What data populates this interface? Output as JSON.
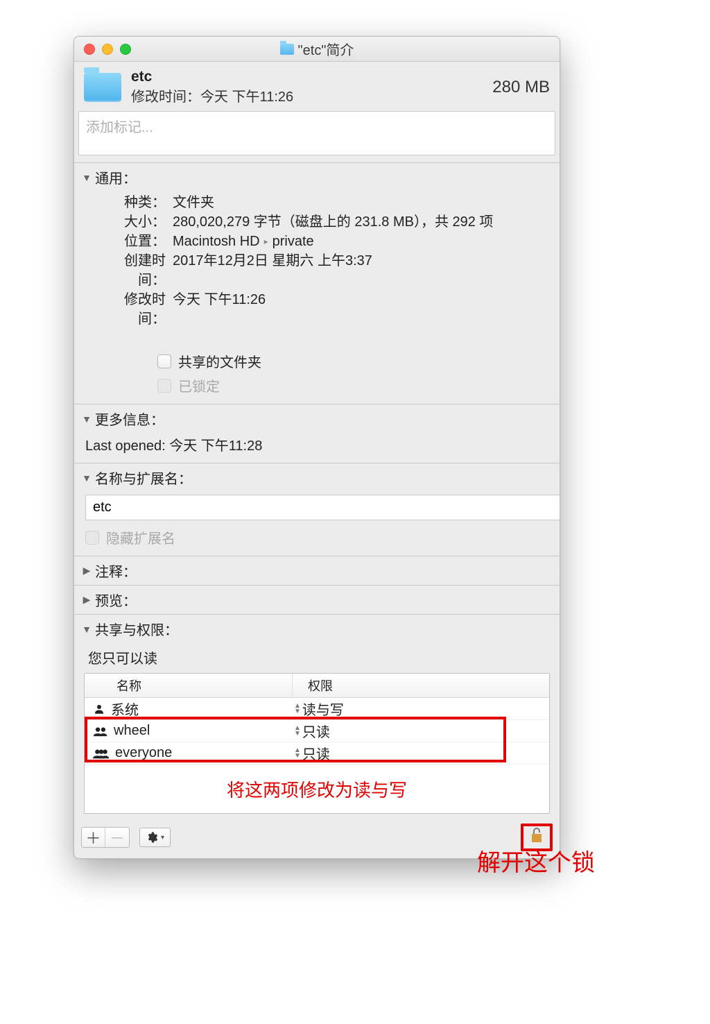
{
  "window": {
    "title": "\"etc\"简介"
  },
  "header": {
    "name": "etc",
    "modified_label": "修改时间：今天 下午11:26",
    "size": "280 MB"
  },
  "tags": {
    "placeholder": "添加标记..."
  },
  "sections": {
    "general": {
      "title": "通用：",
      "kind_label": "种类：",
      "kind_value": "文件夹",
      "size_label": "大小：",
      "size_value": "280,020,279 字节（磁盘上的 231.8 MB），共 292 项",
      "where_label": "位置：",
      "where_value_1": "Macintosh HD",
      "where_value_2": "private",
      "created_label": "创建时间：",
      "created_value": "2017年12月2日 星期六 上午3:37",
      "modified_label": "修改时间：",
      "modified_value": "今天 下午11:26",
      "shared_checkbox": "共享的文件夹",
      "locked_checkbox": "已锁定"
    },
    "more_info": {
      "title": "更多信息：",
      "last_opened": "Last opened: 今天 下午11:28"
    },
    "name_ext": {
      "title": "名称与扩展名：",
      "value": "etc",
      "hide_ext": "隐藏扩展名"
    },
    "comments": {
      "title": "注释："
    },
    "preview": {
      "title": "预览："
    },
    "sharing": {
      "title": "共享与权限：",
      "note": "您只可以读",
      "col_name": "名称",
      "col_priv": "权限",
      "rows": [
        {
          "name": "系统",
          "priv": "读与写",
          "icon": "person"
        },
        {
          "name": "wheel",
          "priv": "只读",
          "icon": "group"
        },
        {
          "name": "everyone",
          "priv": "只读",
          "icon": "group"
        }
      ],
      "annotation_rows": "将这两项修改为读与写"
    }
  },
  "annotations": {
    "unlock": "解开这个锁"
  }
}
